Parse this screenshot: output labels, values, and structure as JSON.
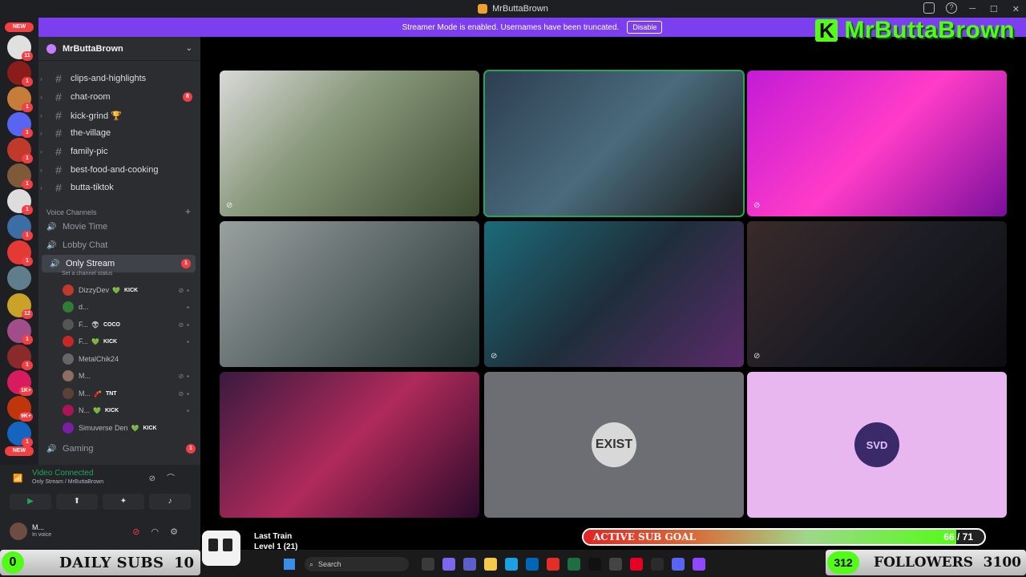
{
  "window": {
    "title": "MrButtaBrown"
  },
  "banner": {
    "text": "Streamer Mode is enabled. Usernames have been truncated.",
    "disable_label": "Disable"
  },
  "brand": {
    "name": "MrButtaBrown",
    "logo_letter": "K",
    "color": "#53fc18"
  },
  "rail": {
    "new_label": "NEW",
    "badges": [
      "11",
      "1",
      "1",
      "1",
      "1",
      "1",
      "1",
      "1",
      "1",
      "12",
      "1",
      "1",
      "1K+",
      "9K+",
      "1",
      "1"
    ]
  },
  "sidebar": {
    "server_name": "MrButtaBrown",
    "channels": [
      {
        "name": "clips-and-highlights",
        "badge": ""
      },
      {
        "name": "chat-room",
        "badge": "8"
      },
      {
        "name": "kick-grind 🏆",
        "badge": ""
      },
      {
        "name": "the-village",
        "badge": ""
      },
      {
        "name": "family-pic",
        "badge": ""
      },
      {
        "name": "best-food-and-cooking",
        "badge": ""
      },
      {
        "name": "butta-tiktok",
        "badge": ""
      }
    ],
    "voice_category": "Voice Channels",
    "voice_channels": [
      {
        "name": "Movie Time"
      },
      {
        "name": "Lobby Chat"
      },
      {
        "name": "Only Stream",
        "badge": "1",
        "status": "Set a channel status"
      },
      {
        "name": "Gaming",
        "badge": "1"
      }
    ],
    "voice_users": [
      {
        "name": "DizzyDev",
        "tag": "KICK",
        "heart": "💚",
        "color": "#c0392b"
      },
      {
        "name": "d...",
        "tag": "",
        "heart": "",
        "color": "#2e7d32"
      },
      {
        "name": "F...",
        "tag": "COCO",
        "heart": "👽",
        "color": "#555"
      },
      {
        "name": "F...",
        "tag": "KICK",
        "heart": "💚",
        "color": "#c62828"
      },
      {
        "name": "MetalChik24",
        "tag": "",
        "heart": "",
        "color": "#666"
      },
      {
        "name": "M...",
        "tag": "",
        "heart": "",
        "color": "#8d6e63"
      },
      {
        "name": "M...",
        "tag": "TNT",
        "heart": "🧨",
        "color": "#5d4037"
      },
      {
        "name": "N...",
        "tag": "KICK",
        "heart": "💚",
        "color": "#ad1457"
      },
      {
        "name": "Simuverse Den",
        "tag": "KICK",
        "heart": "💚",
        "color": "#7b1fa2"
      }
    ]
  },
  "voice_panel": {
    "title": "Video Connected",
    "subtitle": "Only Stream / MrButtaBrown"
  },
  "user_panel": {
    "name": "M...",
    "status": "In voice"
  },
  "video_tiles": [
    {
      "bg": "linear-gradient(135deg,#d9d9d9 0%,#8a9a7c 40%,#3c4a30 100%)",
      "muted": true,
      "speaking": false,
      "avatar": ""
    },
    {
      "bg": "linear-gradient(135deg,#2c3e50 0%,#4a6b7c 50%,#1a1a1a 100%)",
      "muted": false,
      "speaking": true,
      "avatar": ""
    },
    {
      "bg": "linear-gradient(135deg,#c31bd6 0%,#ff3cc8 50%,#7a0f9c 100%)",
      "muted": true,
      "speaking": false,
      "avatar": ""
    },
    {
      "bg": "linear-gradient(135deg,#9aa0a0 0%,#5d6868 50%,#223030 100%)",
      "muted": false,
      "speaking": false,
      "avatar": ""
    },
    {
      "bg": "linear-gradient(135deg,#1c6b7a 0%,#1f2e3a 50%,#5a2a6a 100%)",
      "muted": true,
      "speaking": false,
      "avatar": ""
    },
    {
      "bg": "linear-gradient(135deg,#3a2a2a 0%,#1c1c24 50%,#0c0c10 100%)",
      "muted": true,
      "speaking": false,
      "avatar": ""
    },
    {
      "bg": "linear-gradient(135deg,#3a1a40 0%,#b02a5a 50%,#2a0a2a 100%)",
      "muted": false,
      "speaking": false,
      "avatar": ""
    },
    {
      "bg": "#6d6e73",
      "muted": false,
      "speaking": false,
      "avatar": "EXIST"
    },
    {
      "bg": "#e8b7f0",
      "muted": false,
      "speaking": false,
      "avatar": "SVD"
    }
  ],
  "overlay": {
    "daily_subs": {
      "count": "0",
      "label": "DAILY SUBS",
      "goal": "10"
    },
    "followers": {
      "count": "312",
      "label": "FOLLOWERS",
      "goal": "3100"
    },
    "music": {
      "title": "Last Train",
      "level": "Level 1  (21)"
    },
    "sub_goal": {
      "label": "ACTIVE SUB GOAL",
      "count": "66 / 71",
      "progress": 0.93
    }
  },
  "taskbar": {
    "search_placeholder": "Search"
  }
}
